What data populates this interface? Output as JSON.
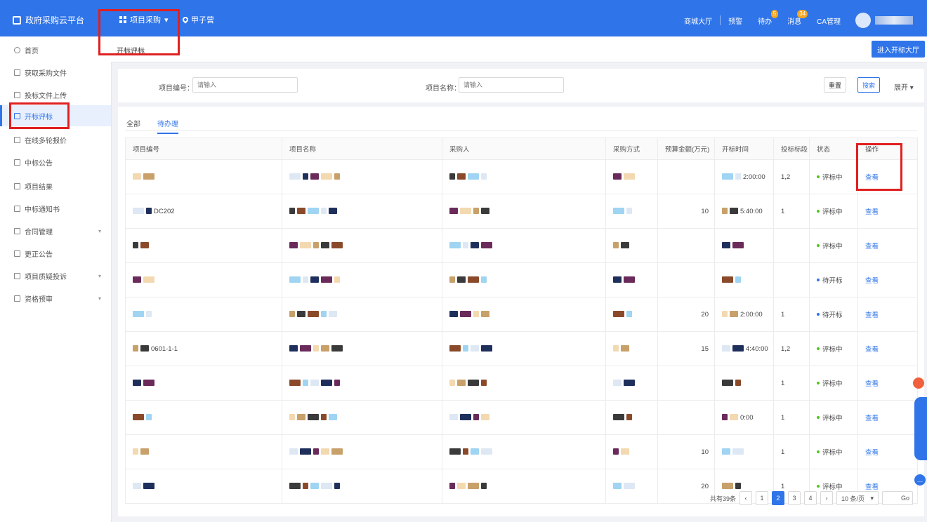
{
  "header": {
    "brand": "政府采购云平台",
    "project_menu": "项目采购",
    "location": "甲子营",
    "links": [
      "商城大厅",
      "预警",
      "待办",
      "消息",
      "CA管理"
    ],
    "badges": {
      "todo": "5",
      "msg": "34"
    }
  },
  "sidebar": {
    "items": [
      {
        "label": "首页"
      },
      {
        "label": "获取采购文件"
      },
      {
        "label": "投标文件上传"
      },
      {
        "label": "开标评标"
      },
      {
        "label": "在线多轮报价"
      },
      {
        "label": "中标公告"
      },
      {
        "label": "项目结果"
      },
      {
        "label": "中标通知书"
      },
      {
        "label": "合同管理"
      },
      {
        "label": "更正公告"
      },
      {
        "label": "项目质疑投诉"
      },
      {
        "label": "资格预审"
      }
    ]
  },
  "breadcrumb": "开标评标",
  "enter_hall": "进入开标大厅",
  "filter": {
    "code_label": "项目编号：",
    "code_placeholder": "请输入",
    "name_label": "项目名称：",
    "name_placeholder": "请输入",
    "reset": "重置",
    "search": "搜索",
    "expand": "展开"
  },
  "tabs": [
    "全部",
    "待办理"
  ],
  "table": {
    "columns": [
      "项目编号",
      "项目名称",
      "采购人",
      "采购方式",
      "预算金额(万元)",
      "开标时间",
      "投标标段",
      "状态",
      "操作"
    ],
    "rows": [
      {
        "budget": "",
        "time": "2:00:00",
        "section": "1,2",
        "status": "评标中",
        "action": "查看"
      },
      {
        "code": "DC202",
        "budget": "10",
        "time": "5:40:00",
        "section": "1",
        "status": "评标中",
        "action": "查看"
      },
      {
        "budget": "",
        "time": "",
        "section": "",
        "status": "评标中",
        "action": "查看"
      },
      {
        "budget": "",
        "time": "",
        "section": "",
        "status": "待开标",
        "action": "查看"
      },
      {
        "budget": "20",
        "time": "2:00:00",
        "section": "1",
        "status": "待开标",
        "action": "查看"
      },
      {
        "code": "0601-1-1",
        "budget": "15",
        "time": "4:40:00",
        "section": "1,2",
        "status": "评标中",
        "action": "查看"
      },
      {
        "budget": "",
        "time": "",
        "section": "1",
        "status": "评标中",
        "action": "查看"
      },
      {
        "budget": "",
        "time": "0:00",
        "section": "1",
        "status": "评标中",
        "action": "查看"
      },
      {
        "budget": "10",
        "time": "",
        "section": "1",
        "status": "评标中",
        "action": "查看"
      },
      {
        "budget": "20",
        "time": "",
        "section": "1",
        "status": "评标中",
        "action": "查看"
      }
    ]
  },
  "pager": {
    "total": "共有39条",
    "pages": [
      "1",
      "2",
      "3",
      "4"
    ],
    "size": "10 条/页",
    "go": "Go"
  }
}
